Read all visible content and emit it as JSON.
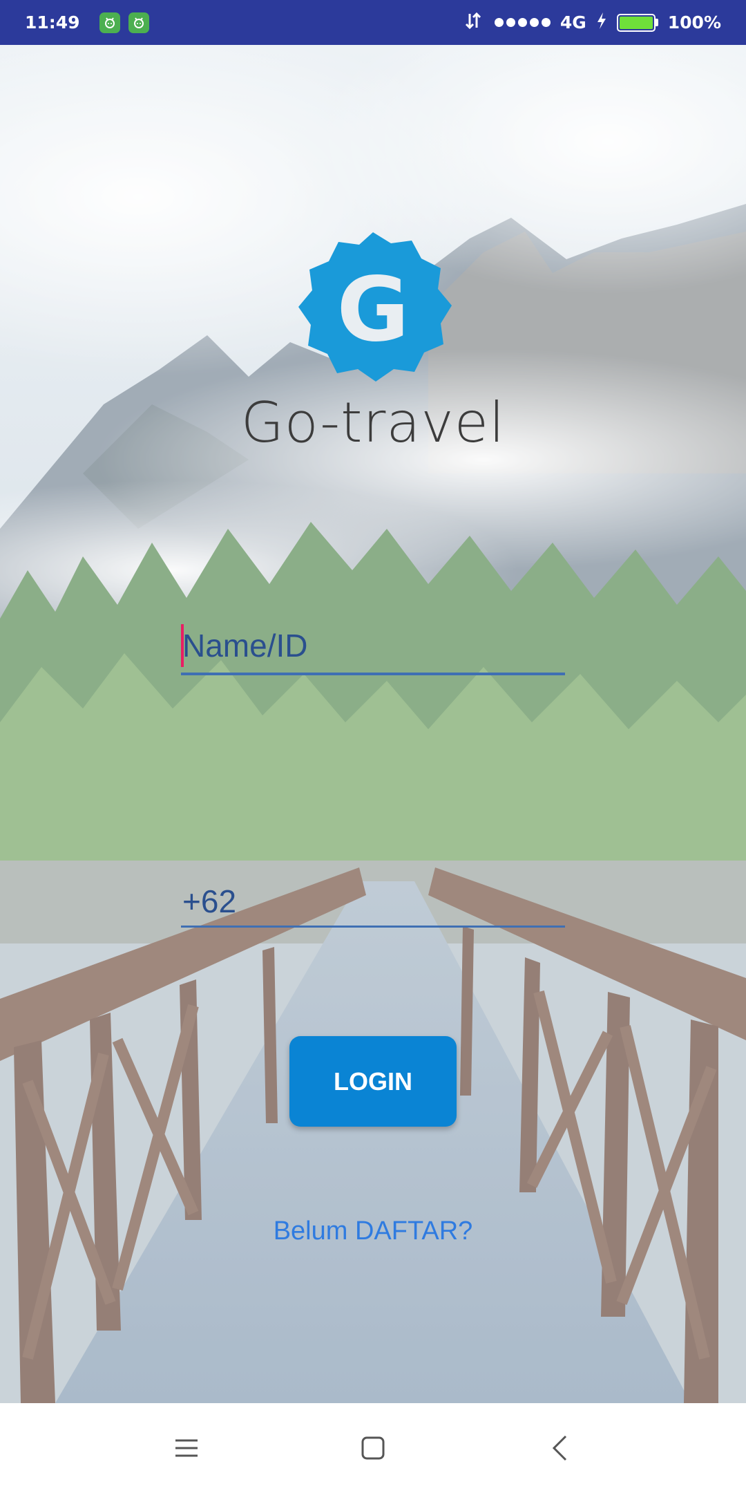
{
  "status_bar": {
    "time": "11:49",
    "network": "4G",
    "battery_level": 1.0,
    "battery_text": "100%"
  },
  "brand": {
    "logo_letter": "G",
    "name": "Go-travel",
    "logo_color": "#1a9ad9"
  },
  "login_form": {
    "name_placeholder": "Name/ID",
    "phone_value": "+62",
    "login_label": "LOGIN",
    "register_link": "Belum DAFTAR?"
  },
  "colors": {
    "status_bar": "#2c3a9b",
    "accent": "#0a84d4",
    "link": "#2f7be0",
    "cursor": "#e91e63"
  },
  "icons": {
    "nav_menu": "menu-icon",
    "nav_home": "home-square-icon",
    "nav_back": "back-chevron-icon"
  }
}
